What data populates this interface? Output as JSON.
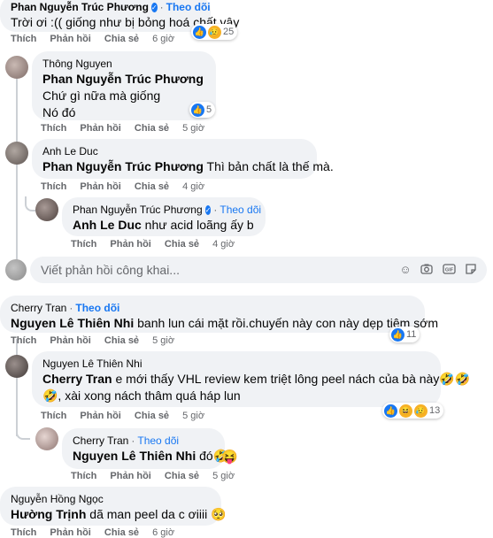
{
  "colors": {
    "bubble": "#f0f2f5",
    "follow": "#1877f2",
    "meta": "#65676b"
  },
  "comments": [
    {
      "author": "Phan Nguyễn Trúc Phương",
      "verified": true,
      "follow": "Theo dõi",
      "text": "Trời ơi :(( giống như bị bỏng hoá chất vậy",
      "actions": {
        "like": "Thích",
        "reply": "Phản hồi",
        "share": "Chia sẻ",
        "time": "6 giờ"
      },
      "reaction_count": "25"
    },
    {
      "author": "Thông Nguyen",
      "mention": "Phan Nguyễn Trúc Phương",
      "line2": "Chứ gì nữa mà giống",
      "line3": "Nó đó",
      "actions": {
        "like": "Thích",
        "reply": "Phản hồi",
        "share": "Chia sẻ",
        "time": "5 giờ"
      },
      "reaction_count": "5"
    },
    {
      "author": "Anh Le Duc",
      "mention": "Phan Nguyễn Trúc Phương",
      "text": " Thì bản chất là thế mà.",
      "actions": {
        "like": "Thích",
        "reply": "Phản hồi",
        "share": "Chia sẻ",
        "time": "4 giờ"
      }
    },
    {
      "author": "Phan Nguyễn Trúc Phương",
      "verified": true,
      "follow": "Theo dõi",
      "mention": "Anh Le Duc",
      "text": " như acid loãng ấy b",
      "actions": {
        "like": "Thích",
        "reply": "Phản hồi",
        "share": "Chia sẻ",
        "time": "4 giờ"
      }
    },
    {
      "author": "Cherry Tran",
      "follow": "Theo dõi",
      "mention": "Nguyen Lê Thiên Nhi",
      "text": " banh lun cái mặt rồi.chuyến này con này dẹp tiệm sớm",
      "actions": {
        "like": "Thích",
        "reply": "Phản hồi",
        "share": "Chia sẻ",
        "time": "5 giờ"
      },
      "reaction_count": "11"
    },
    {
      "author": "Nguyen Lê Thiên Nhi",
      "mention": "Cherry Tran",
      "text": " e mới thấy VHL review kem triệt lông peel nách của bà này🤣🤣",
      "line2": "🤣, xài xong nách thâm quá háp lun",
      "actions": {
        "like": "Thích",
        "reply": "Phản hồi",
        "share": "Chia sẻ",
        "time": "5 giờ"
      },
      "reaction_count": "13"
    },
    {
      "author": "Cherry Tran",
      "follow": "Theo dõi",
      "mention": "Nguyen Lê Thiên Nhi",
      "text": " đó🤣",
      "emoji": "😝",
      "actions": {
        "like": "Thích",
        "reply": "Phản hồi",
        "share": "Chia sẻ",
        "time": "5 giờ"
      }
    },
    {
      "author": "Nguyễn Hồng Ngọc",
      "mention": "Hường Trịnh",
      "text": " dã man peel da c ơiiii",
      "emoji": "🥺",
      "actions": {
        "like": "Thích",
        "reply": "Phản hồi",
        "share": "Chia sẻ",
        "time": "6 giờ"
      }
    }
  ],
  "composer": {
    "placeholder": "Viết phản hồi công khai...",
    "icons": [
      "emoji-icon",
      "camera-icon",
      "gif-icon",
      "sticker-icon"
    ]
  }
}
